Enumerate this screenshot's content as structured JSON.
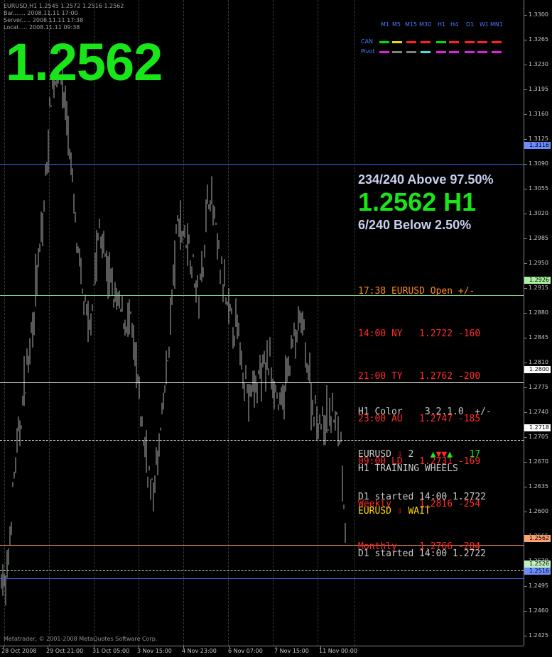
{
  "chart_info": {
    "symbol_line": "EURUSD,H1  1.2545 1.2572 1.2516 1.2562",
    "bar_line": "Bar....... 2008.11.11 17:00",
    "server_line": "Server..... 2008.11.11 17:38",
    "local_line": "Local..... 2008.11.11 09:38"
  },
  "big_price": "1.2562",
  "timeframe_panel": {
    "headers": [
      "M1",
      "M5",
      "M15",
      "M30",
      "H1",
      "H4",
      "D1",
      "W1",
      "MN1"
    ],
    "rows": [
      {
        "label": "CAN",
        "colors": [
          "#00e000",
          "#e0e000",
          "#ff2020",
          "#ff2020",
          "#00e000",
          "#ff2020",
          "#ff2020",
          "#ff2020",
          "#ff2020"
        ]
      },
      {
        "label": "Pivot",
        "colors": [
          "#e020e0",
          "#808080",
          "#808080",
          "#40e0e0",
          "#e020e0",
          "#e020e0",
          "#e020e0",
          "#e020e0",
          "#e020e0"
        ]
      }
    ]
  },
  "percent_panel": {
    "above": "234/240 Above 97.50%",
    "price_tf": "1.2562 H1",
    "below": "6/240 Below 2.50%"
  },
  "session_opens": {
    "header": "17:38 EURUSD Open +/-",
    "rows": [
      "14:00 NY   1.2722 -160",
      "21:00 TY   1.2762 -200",
      "23:00 AU   1.2747 -185",
      "09:00 LD   1.2731 -169",
      "Weekly     1.2816 -254",
      "Monthly    1.2766 -204"
    ]
  },
  "h1_color": {
    "title": "H1 Color    3.2.1.0  +/-",
    "symbol": "EURUSD",
    "count": "2",
    "pips": "17",
    "started": "D1 started 14:00 1.2722"
  },
  "training_wheels": {
    "title": "H1 TRAINING WHEELS",
    "status": "EURUSD",
    "wait": "WAIT",
    "started": "D1 started 14:00 1.2722"
  },
  "price_axis": {
    "labels": [
      "1.3300",
      "1.3265",
      "1.3230",
      "1.3195",
      "1.3160",
      "1.3125",
      "1.3090",
      "1.3055",
      "1.3020",
      "1.2985",
      "1.2950",
      "1.2915",
      "1.2880",
      "1.2845",
      "1.2810",
      "1.2775",
      "1.2740",
      "1.2705",
      "1.2670",
      "1.2635",
      "1.2600",
      "1.2565",
      "1.2530",
      "1.2495",
      "1.2460",
      "1.2425"
    ],
    "tags": [
      {
        "value": "1.3116",
        "color": "#6a8cff"
      },
      {
        "value": "1.2926",
        "color": "#a8f0a0"
      },
      {
        "value": "1.2800",
        "color": "#ffffff"
      },
      {
        "value": "1.2718",
        "color": "#ffffff"
      },
      {
        "value": "1.2562",
        "color": "#ffa070"
      },
      {
        "value": "1.2526",
        "color": "#c0f0c0"
      },
      {
        "value": "1.2516",
        "color": "#6a8cff"
      }
    ]
  },
  "time_axis": [
    "28 Oct 2008",
    "29 Oct 21:00",
    "31 Oct 05:00",
    "3 Nov 15:00",
    "4 Nov 23:00",
    "6 Nov 07:00",
    "7 Nov 15:00",
    "11 Nov 00:00"
  ],
  "copyright": "Metatrader, © 2001-2008 MetaQuotes Software Corp."
}
